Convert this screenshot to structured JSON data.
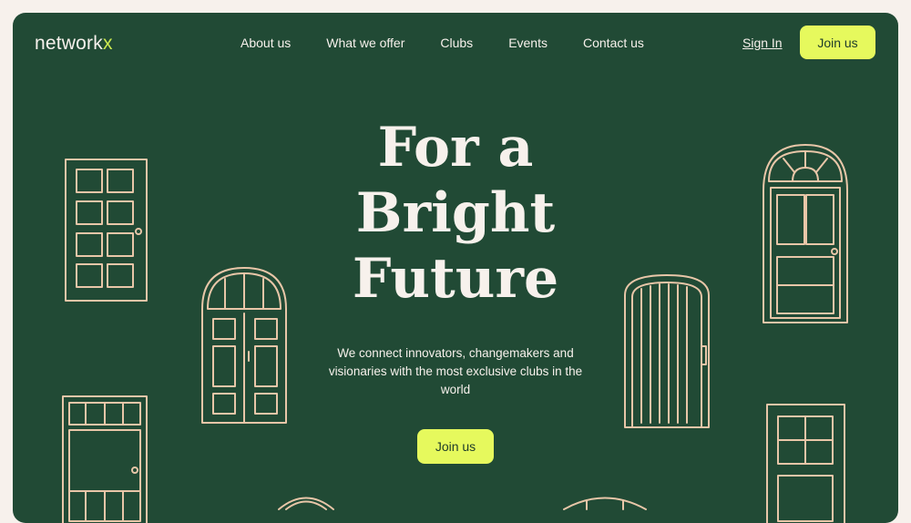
{
  "brand": {
    "logo_main": "network",
    "logo_accent": "x"
  },
  "nav": {
    "links": [
      "About us",
      "What we offer",
      "Clubs",
      "Events",
      "Contact us"
    ],
    "sign_in": "Sign In",
    "join": "Join us"
  },
  "hero": {
    "headline": [
      "For a",
      "Bright",
      "Future"
    ],
    "subtitle": "We connect innovators, changemakers and visionaries with the most exclusive clubs in the world",
    "cta": "Join us"
  },
  "colors": {
    "background": "#214a35",
    "page": "#f7f1ec",
    "accent": "#e6f95d",
    "line_art": "#e8c6a8"
  }
}
